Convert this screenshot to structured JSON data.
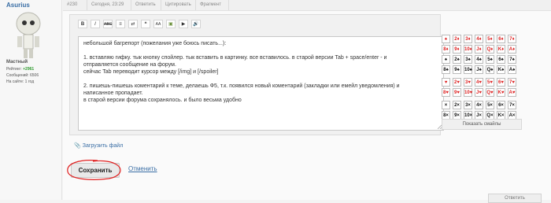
{
  "user": {
    "name": "Asurius",
    "rank": "Мастный",
    "rating_label": "Рейтинг:",
    "rating_value": "+2961",
    "posts": "Сообщений: 6506",
    "onsite": "На сайте: 1 год"
  },
  "postbar": {
    "number": "#230",
    "date": "Сегодня, 23:29",
    "reply": "Ответить",
    "quote": "Цитировать",
    "fragment": "Фрагмент"
  },
  "toolbar": {
    "buttons": [
      "B",
      "I",
      "ABC",
      "≡",
      "⇄",
      "❝",
      "AA",
      "▣",
      "▶",
      "🔊"
    ]
  },
  "editor": {
    "lines": [
      "небольшой багрепорт (пожелания уже боюсь писать...):",
      "",
      "1. вставляю гифку. тык кнопку спойлер. тык вставить в картинку. все вставилось. в старой версии Tab + space/enter - и",
      "отправляется сообщение на форум.",
      "сейчас Tab переводит курсор между [/img] и [/spoiler]",
      "",
      "2. пишешь-пишешь коментарий к теме, делаешь Ф5, т.к. появился новый коментарий (закладки или емейл уведомления) и",
      "написанное пропадает.",
      "в старой версии форума сохранялось. и было весьма удобно"
    ]
  },
  "cards": {
    "rows": [
      [
        "♠",
        "2♦",
        "3♦",
        "4♦",
        "5♦",
        "6♦",
        "7♦"
      ],
      [
        "8♦",
        "9♦",
        "10♦",
        "J♦",
        "Q♦",
        "K♦",
        "A♦"
      ],
      [
        "♠",
        "2♠",
        "3♠",
        "4♠",
        "5♠",
        "6♠",
        "7♠"
      ],
      [
        "8♠",
        "9♠",
        "10♠",
        "J♠",
        "Q♠",
        "K♠",
        "A♠"
      ],
      [
        "♥",
        "2♥",
        "3♥",
        "4♥",
        "5♥",
        "6♥",
        "7♥"
      ],
      [
        "8♥",
        "9♥",
        "10♥",
        "J♥",
        "Q♥",
        "K♥",
        "A♥"
      ],
      [
        "×",
        "2×",
        "3×",
        "4×",
        "5×",
        "6×",
        "7×"
      ],
      [
        "8×",
        "9×",
        "10×",
        "J×",
        "Q×",
        "K×",
        "A×"
      ]
    ],
    "red_rows": [
      0,
      1,
      4,
      5
    ],
    "show_smilies": "Показать смайлы"
  },
  "actions": {
    "upload_file": "Загрузить файл",
    "save": "Сохранить",
    "cancel": "Отменить",
    "reply": "Ответить"
  },
  "colors": {
    "link": "#3a6ea5",
    "rating": "#2e9a2e",
    "highlight_circle": "#e02020"
  }
}
